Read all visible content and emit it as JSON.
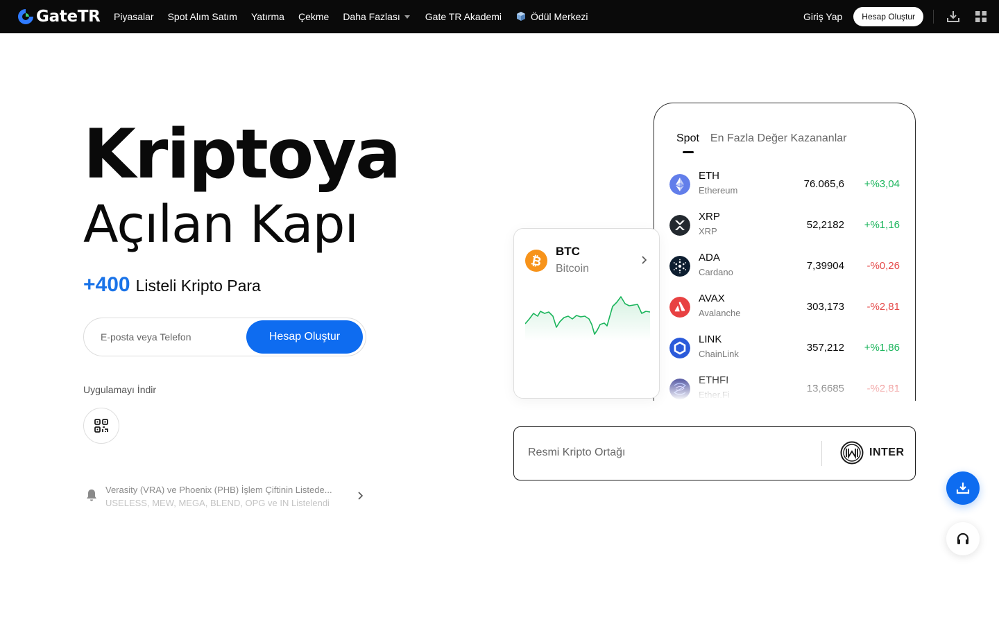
{
  "nav": {
    "logo_text": "GateTR",
    "items": [
      {
        "label": "Piyasalar"
      },
      {
        "label": "Spot Alım Satım"
      },
      {
        "label": "Yatırma"
      },
      {
        "label": "Çekme"
      },
      {
        "label": "Daha Fazlası"
      },
      {
        "label": "Gate TR Akademi"
      },
      {
        "label": "Ödül Merkezi"
      }
    ],
    "login_label": "Giriş Yap",
    "signup_label": "Hesap Oluştur"
  },
  "hero": {
    "line1": "Kriptoya",
    "line2_plain": "Açılan",
    "line2_highlight": "Kapı",
    "count": "+400",
    "count_label": "Listeli Kripto Para",
    "email_placeholder": "E-posta veya Telefon",
    "cta_label": "Hesap Oluştur",
    "app_label": "Uygulamayı İndir",
    "highlight_color": "#a6f05a",
    "accent_color": "#0e6cf0"
  },
  "notice": {
    "line1": "Verasity (VRA) ve Phoenix (PHB) İşlem Çiftinin Listede...",
    "line2": "USELESS, MEW, MEGA, BLEND, OPG ve IN Listelendi"
  },
  "market": {
    "tabs": [
      {
        "label": "Spot",
        "active": true
      },
      {
        "label": "En Fazla Değer Kazananlar",
        "active": false
      }
    ],
    "rows": [
      {
        "symbol": "ETH",
        "name": "Ethereum",
        "price": "76.065,6",
        "change": "+%3,04",
        "direction": "up",
        "icon": "eth-icon",
        "color": "#627eea"
      },
      {
        "symbol": "XRP",
        "name": "XRP",
        "price": "52,2182",
        "change": "+%1,16",
        "direction": "up",
        "icon": "xrp-icon",
        "color": "#23292f"
      },
      {
        "symbol": "ADA",
        "name": "Cardano",
        "price": "7,39904",
        "change": "-%0,26",
        "direction": "down",
        "icon": "ada-icon",
        "color": "#0d1e30"
      },
      {
        "symbol": "AVAX",
        "name": "Avalanche",
        "price": "303,173",
        "change": "-%2,81",
        "direction": "down",
        "icon": "avax-icon",
        "color": "#e84142"
      },
      {
        "symbol": "LINK",
        "name": "ChainLink",
        "price": "357,212",
        "change": "+%1,86",
        "direction": "up",
        "icon": "link-icon",
        "color": "#2a5ada"
      },
      {
        "symbol": "ETHFI",
        "name": "Ether.Fi",
        "price": "13,6685",
        "change": "-%2,81",
        "direction": "down",
        "icon": "ethfi-icon",
        "color": "#2b2f8c"
      }
    ],
    "up_color": "#1bb55c",
    "down_color": "#e54a4a"
  },
  "btc_card": {
    "symbol": "BTC",
    "name": "Bitcoin",
    "icon": "btc-icon",
    "color": "#f7931a"
  },
  "partner": {
    "label": "Resmi Kripto Ortağı",
    "name": "INTER"
  }
}
